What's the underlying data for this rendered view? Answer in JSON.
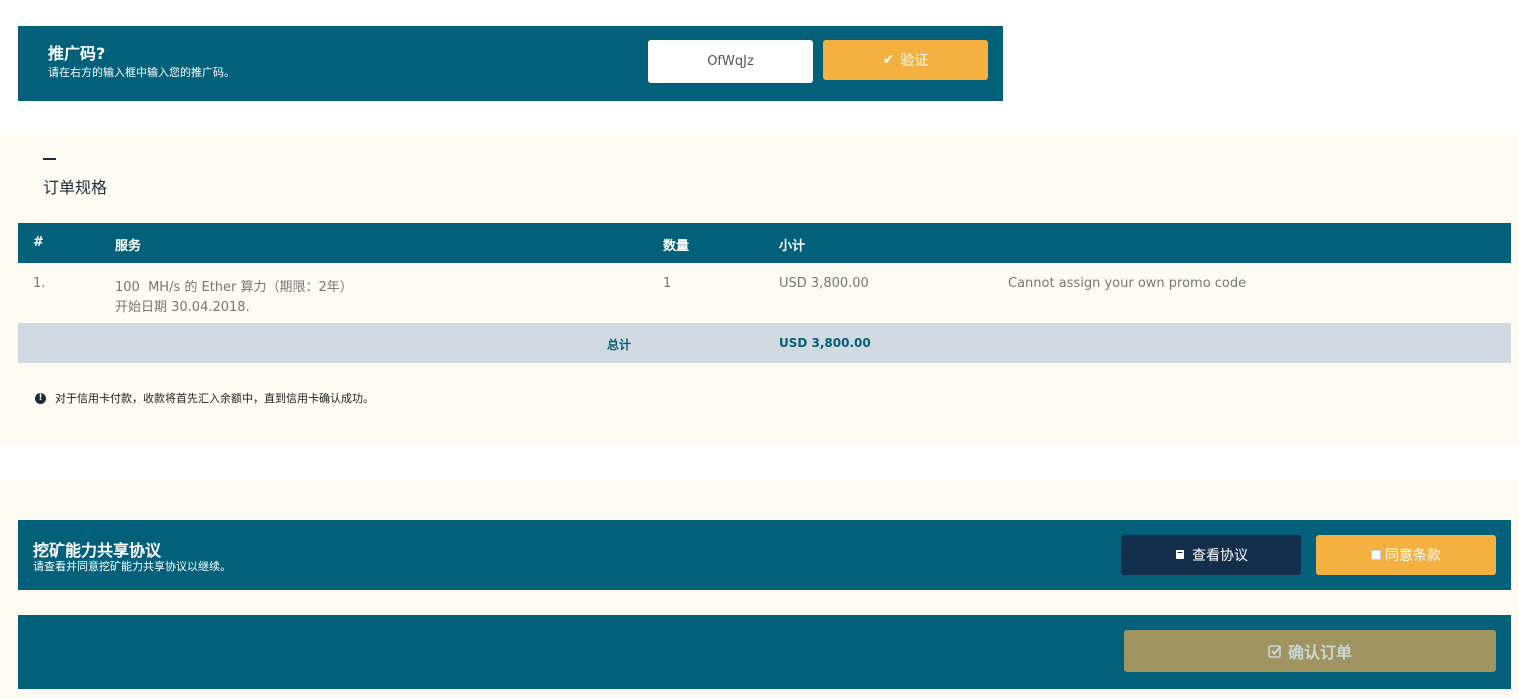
{
  "promo": {
    "title": "推广码?",
    "subtitle": "请在右方的输入框中输入您的推广码。",
    "input_value": "OfWqJz",
    "verify_icon": "✔",
    "verify_label": "验证"
  },
  "order": {
    "heading": "订单规格",
    "columns": {
      "index": "#",
      "service": "服务",
      "quantity": "数量",
      "subtotal": "小计"
    },
    "rows": [
      {
        "index": "1.",
        "service_line1": "100  MH/s 的 Ether 算力（期限：2年）",
        "service_line2": "开始日期 30.04.2018.",
        "quantity": "1",
        "subtotal": "USD 3,800.00",
        "message": "Cannot assign your own promo code"
      }
    ],
    "total_label": "总计",
    "total_value": "USD 3,800.00",
    "note": "对于信用卡付款，收款将首先汇入余额中，直到信用卡确认成功。"
  },
  "agreement": {
    "title": "挖矿能力共享协议",
    "subtitle": "请查看并同意挖矿能力共享协议以继续。",
    "view_label": "查看协议",
    "agree_label": "同意条款"
  },
  "confirm": {
    "label": "确认订单"
  },
  "colors": {
    "primary": "#02607a",
    "accent": "#f4b140",
    "dark_button": "#132e4b",
    "disabled_button": "#a09560",
    "section_bg": "#fefbf2",
    "total_row_bg": "#d0dae0"
  }
}
